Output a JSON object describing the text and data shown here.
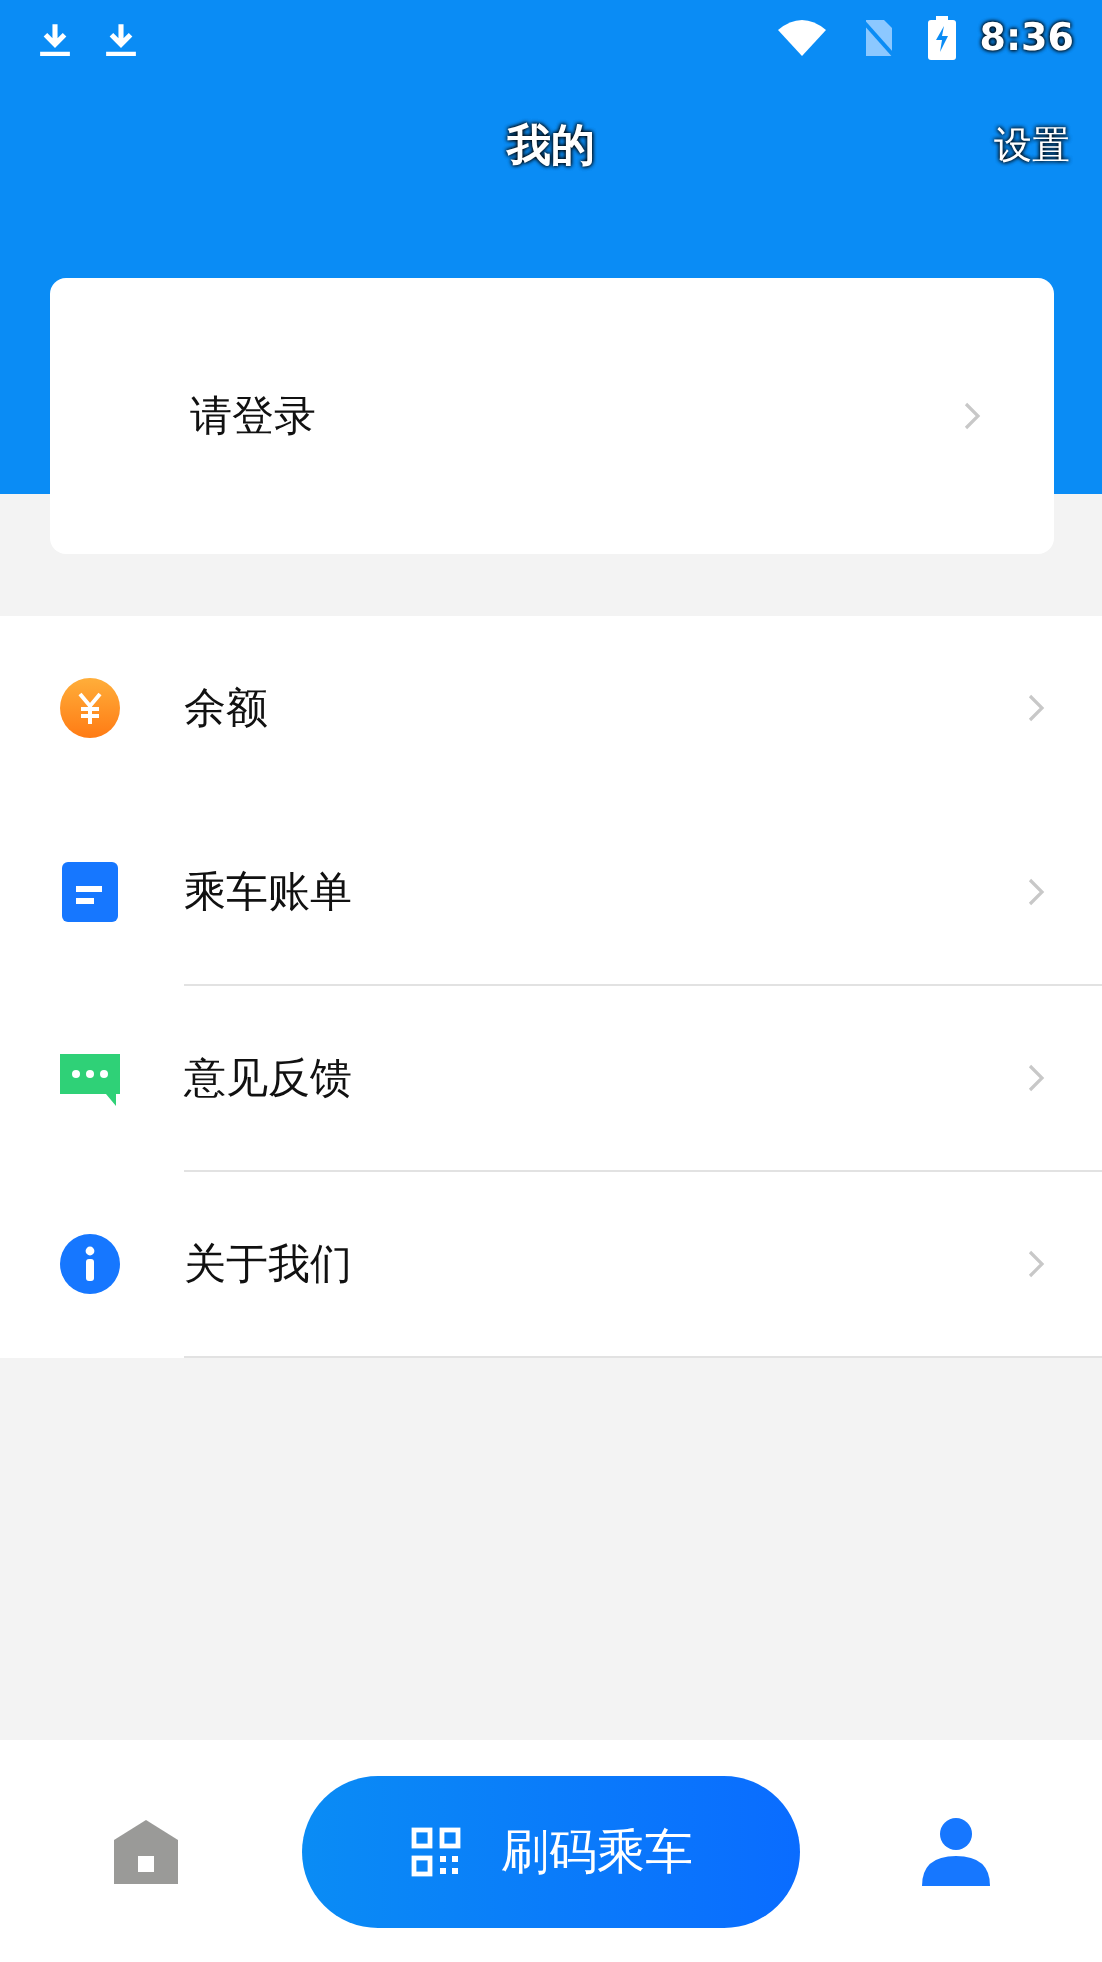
{
  "status_bar": {
    "time": "8:36"
  },
  "header": {
    "title": "我的",
    "action": "设置"
  },
  "login_card": {
    "label": "请登录"
  },
  "menu": [
    {
      "kind": "balance",
      "label": "余额"
    },
    {
      "kind": "bill",
      "label": "乘车账单"
    },
    {
      "kind": "feedback",
      "label": "意见反馈"
    },
    {
      "kind": "about",
      "label": "关于我们"
    }
  ],
  "bottom_nav": {
    "tabs": [
      {
        "kind": "home",
        "selected": false
      },
      {
        "kind": "profile",
        "selected": true
      }
    ],
    "scan_button": "刷码乘车"
  }
}
